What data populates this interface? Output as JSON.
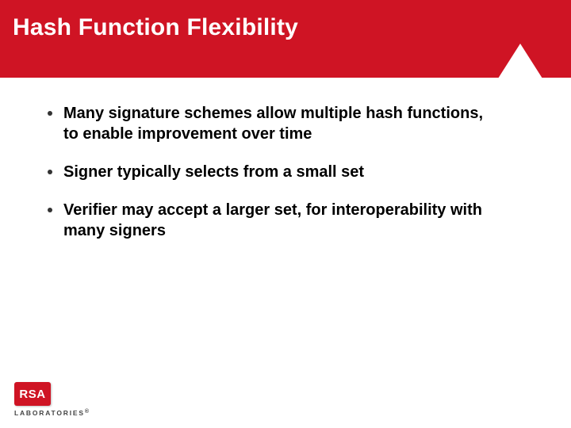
{
  "header": {
    "title": "Hash Function Flexibility"
  },
  "content": {
    "bullets": [
      "Many signature schemes allow multiple hash functions, to enable improvement over time",
      "Signer typically selects from a small set",
      "Verifier may accept a larger set, for interoperability with many signers"
    ]
  },
  "footer": {
    "logo_text": "RSA",
    "lab_text": "LABORATORIES",
    "registered": "®"
  }
}
